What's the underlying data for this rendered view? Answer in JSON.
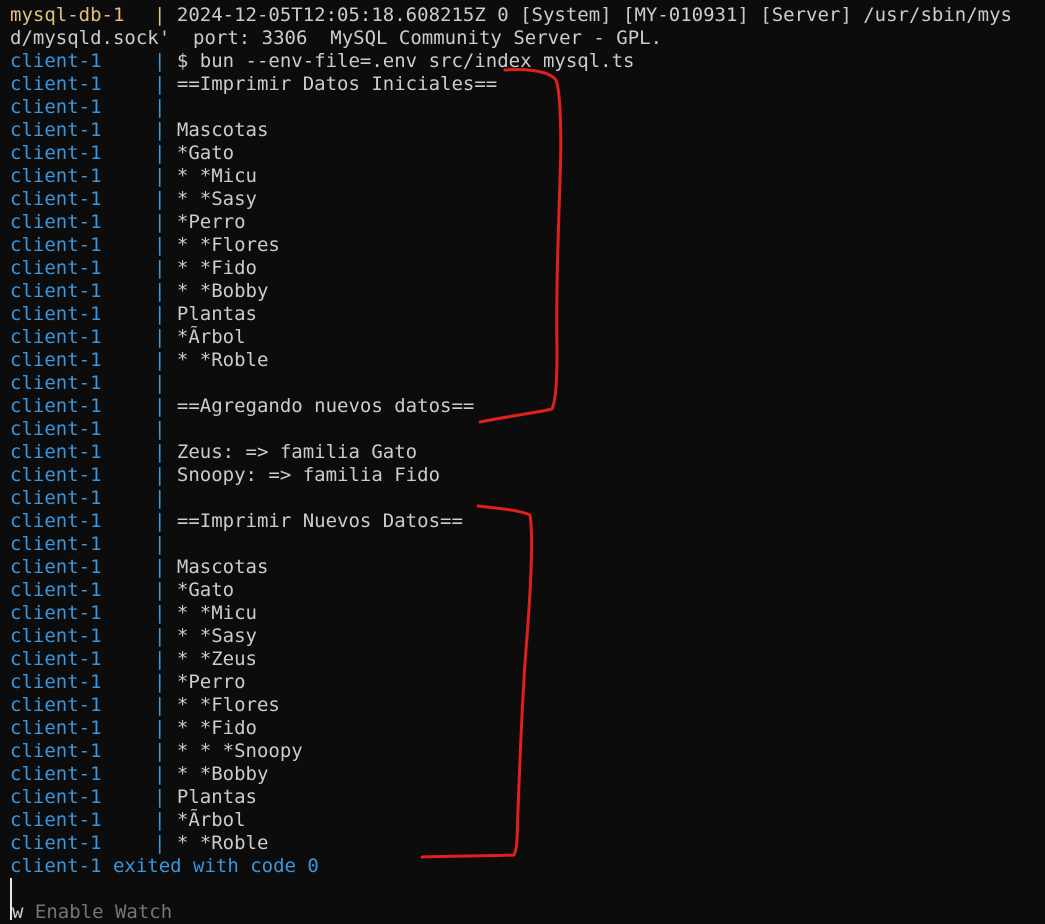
{
  "header": {
    "mysql_service": "mysql-db-1",
    "mysql_separator": "|",
    "mysql_log_line1": "2024-12-05T12:05:18.608215Z 0 [System] [MY-010931] [Server] /usr/sbin/mys",
    "mysql_log_line2": "d/mysqld.sock'  port: 3306  MySQL Community Server - GPL."
  },
  "client": {
    "service": "client-1",
    "separator": "|",
    "lines": [
      "$ bun --env-file=.env src/index_mysql.ts",
      "==Imprimir Datos Iniciales==",
      "",
      "Mascotas",
      "*Gato",
      "* *Micu",
      "* *Sasy",
      "*Perro",
      "* *Flores",
      "* *Fido",
      "* *Bobby",
      "Plantas",
      "*Ãrbol",
      "* *Roble",
      "",
      "==Agregando nuevos datos==",
      "",
      "Zeus: => familia Gato",
      "Snoopy: => familia Fido",
      "",
      "==Imprimir Nuevos Datos==",
      "",
      "Mascotas",
      "*Gato",
      "* *Micu",
      "* *Sasy",
      "* *Zeus",
      "*Perro",
      "* *Flores",
      "* *Fido",
      "* * *Snoopy",
      "* *Bobby",
      "Plantas",
      "*Ãrbol",
      "* *Roble"
    ],
    "exit_message": "client-1 exited with code 0"
  },
  "footer": {
    "watch_key": "w",
    "watch_label": " Enable Watch"
  },
  "colors": {
    "background": "#0c0c0c",
    "text": "#cccccc",
    "client_prefix": "#3a96dd",
    "mysql_prefix": "#e5c07b",
    "annotation": "#e0201c",
    "hint": "#767676"
  }
}
